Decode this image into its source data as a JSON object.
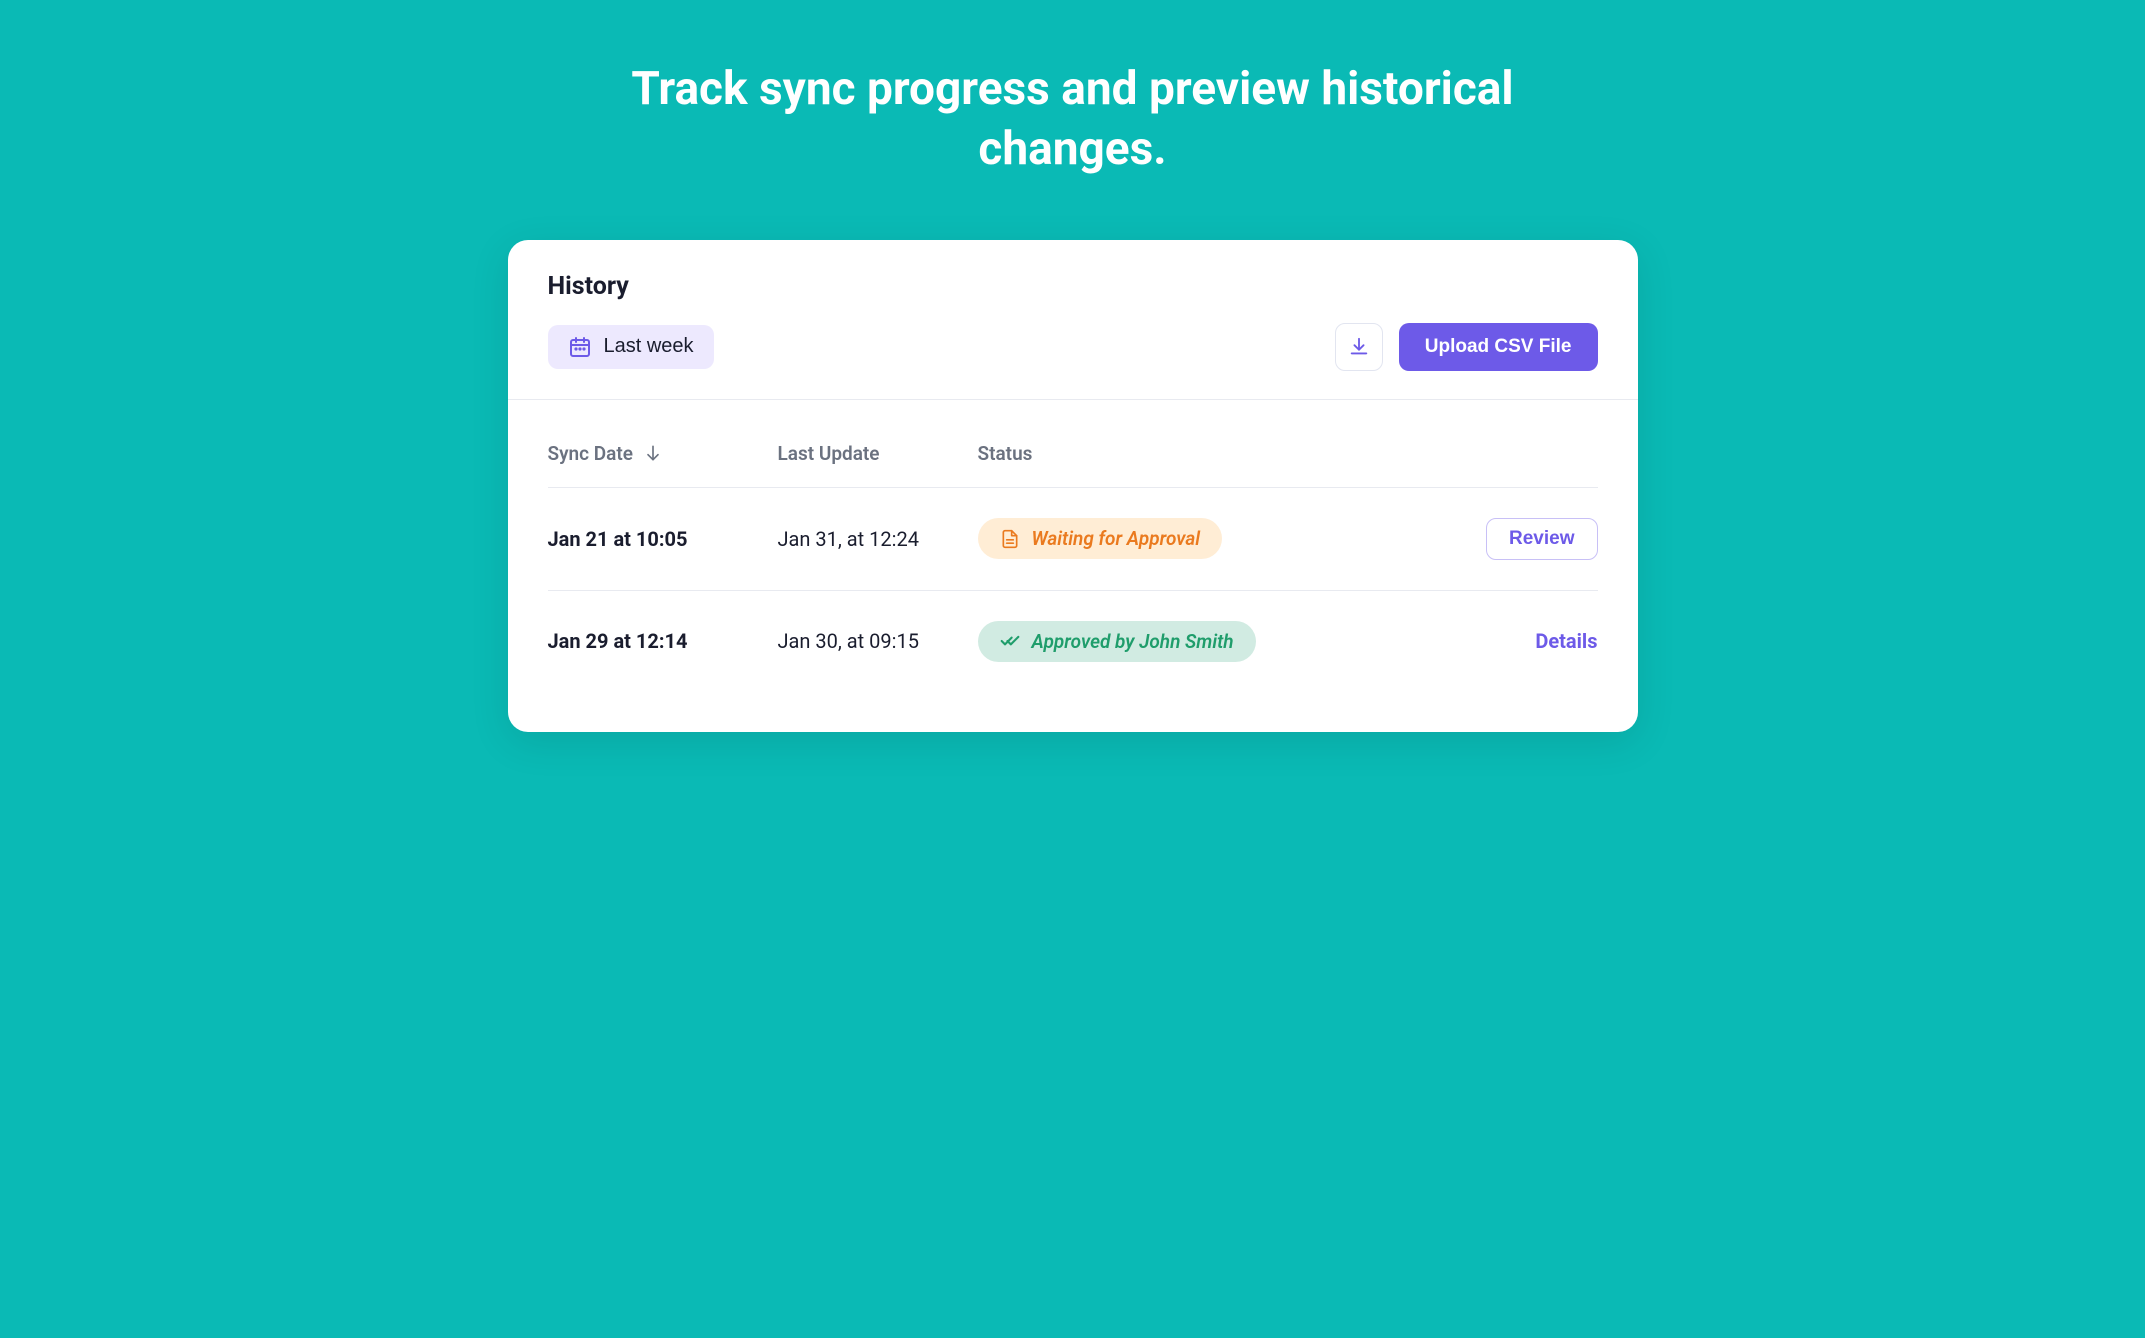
{
  "headline": "Track sync progress and preview historical changes.",
  "card": {
    "title": "History",
    "filter_label": "Last week",
    "download_icon": "download",
    "upload_button_label": "Upload CSV File"
  },
  "table": {
    "headers": {
      "sync_date": "Sync Date",
      "last_update": "Last Update",
      "status": "Status"
    },
    "rows": [
      {
        "sync_date": "Jan 21 at 10:05",
        "last_update": "Jan 31, at 12:24",
        "status_type": "waiting",
        "status_text": "Waiting for Approval",
        "action_label": "Review",
        "action_type": "button"
      },
      {
        "sync_date": "Jan 29 at 12:14",
        "last_update": "Jan 30, at 09:15",
        "status_type": "approved",
        "status_text": "Approved by John Smith",
        "action_label": "Details",
        "action_type": "link"
      }
    ]
  }
}
